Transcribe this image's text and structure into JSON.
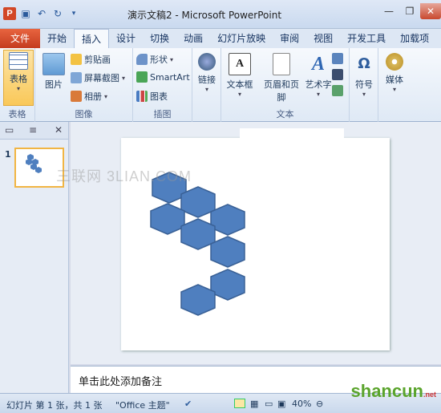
{
  "window": {
    "title": "演示文稿2 - Microsoft PowerPoint",
    "app_icon_letter": "P"
  },
  "quick_access": [
    "save-icon",
    "undo-icon",
    "redo-icon"
  ],
  "tabs": [
    "文件",
    "开始",
    "插入",
    "设计",
    "切换",
    "动画",
    "幻灯片放映",
    "审阅",
    "视图",
    "开发工具",
    "加载项"
  ],
  "active_tab": "插入",
  "ribbon": {
    "groups": {
      "tables": "表格",
      "images": "图像",
      "illustrations": "插图",
      "text": "文本"
    },
    "buttons": {
      "table": "表格",
      "picture": "图片",
      "clipart": "剪贴画",
      "screenshot": "屏幕截图",
      "album": "相册",
      "shapes": "形状",
      "smartart": "SmartArt",
      "chart": "图表",
      "hyperlink": "链接",
      "textbox": "文本框",
      "header_footer": "页眉和页脚",
      "wordart": "艺术字",
      "symbol": "符号",
      "media": "媒体"
    }
  },
  "left_pane": {
    "slide_number": "1"
  },
  "slide": {
    "watermark": "三联网 3LIAN.COM"
  },
  "notes_placeholder": "单击此处添加备注",
  "status": {
    "slide_info": "幻灯片 第 1 张，共 1 张",
    "theme": "\"Office 主题\"",
    "zoom": "40%"
  },
  "site_watermark": {
    "text": "shancun",
    "suffix": ".net"
  },
  "colors": {
    "hex_fill": "#4f7fbf",
    "hex_stroke": "#3a6196",
    "file_tab": "#d24726"
  }
}
